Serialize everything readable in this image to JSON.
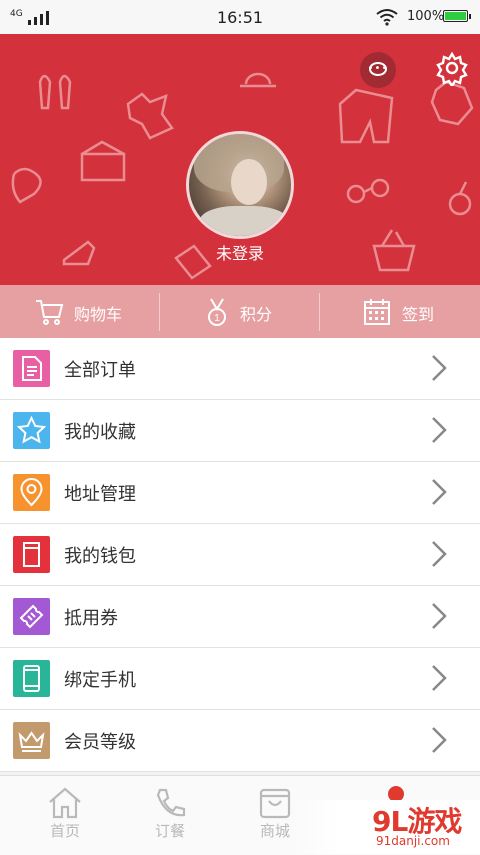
{
  "status_bar": {
    "network": "4G",
    "time": "16:51",
    "battery": "100%"
  },
  "hero": {
    "login_label": "未登录",
    "accent": "#d3313b"
  },
  "quick_actions": [
    {
      "label": "购物车",
      "icon": "cart-icon"
    },
    {
      "label": "积分",
      "icon": "medal-icon"
    },
    {
      "label": "签到",
      "icon": "calendar-icon"
    }
  ],
  "menu": [
    {
      "label": "全部订单",
      "icon": "document-icon",
      "color": "#e95fa4"
    },
    {
      "label": "我的收藏",
      "icon": "star-icon",
      "color": "#4db5ee"
    },
    {
      "label": "地址管理",
      "icon": "location-pin-icon",
      "color": "#f7932f"
    },
    {
      "label": "我的钱包",
      "icon": "wallet-icon",
      "color": "#e4323c"
    },
    {
      "label": "抵用券",
      "icon": "ticket-icon",
      "color": "#a259d3"
    },
    {
      "label": "绑定手机",
      "icon": "phone-icon",
      "color": "#29b598"
    },
    {
      "label": "会员等级",
      "icon": "crown-icon",
      "color": "#c39a6b"
    }
  ],
  "tabs": [
    {
      "label": "首页",
      "icon": "home-icon"
    },
    {
      "label": "订餐",
      "icon": "phone-call-icon"
    },
    {
      "label": "商城",
      "icon": "shopping-bag-icon"
    }
  ],
  "watermark": {
    "logo": "9L游戏",
    "url": "91danji.com"
  }
}
